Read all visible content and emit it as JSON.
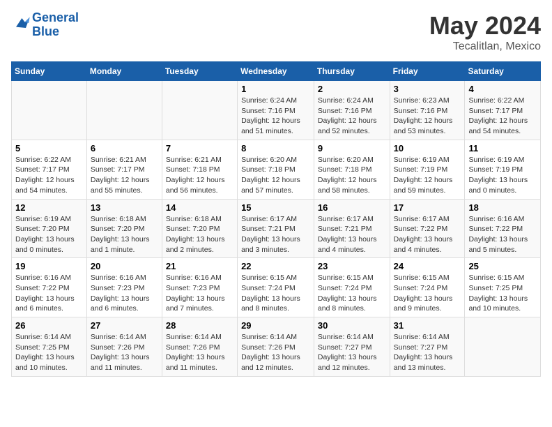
{
  "logo": {
    "line1": "General",
    "line2": "Blue"
  },
  "title": "May 2024",
  "location": "Tecalitlan, Mexico",
  "weekdays": [
    "Sunday",
    "Monday",
    "Tuesday",
    "Wednesday",
    "Thursday",
    "Friday",
    "Saturday"
  ],
  "weeks": [
    [
      {
        "day": "",
        "detail": ""
      },
      {
        "day": "",
        "detail": ""
      },
      {
        "day": "",
        "detail": ""
      },
      {
        "day": "1",
        "detail": "Sunrise: 6:24 AM\nSunset: 7:16 PM\nDaylight: 12 hours\nand 51 minutes."
      },
      {
        "day": "2",
        "detail": "Sunrise: 6:24 AM\nSunset: 7:16 PM\nDaylight: 12 hours\nand 52 minutes."
      },
      {
        "day": "3",
        "detail": "Sunrise: 6:23 AM\nSunset: 7:16 PM\nDaylight: 12 hours\nand 53 minutes."
      },
      {
        "day": "4",
        "detail": "Sunrise: 6:22 AM\nSunset: 7:17 PM\nDaylight: 12 hours\nand 54 minutes."
      }
    ],
    [
      {
        "day": "5",
        "detail": "Sunrise: 6:22 AM\nSunset: 7:17 PM\nDaylight: 12 hours\nand 54 minutes."
      },
      {
        "day": "6",
        "detail": "Sunrise: 6:21 AM\nSunset: 7:17 PM\nDaylight: 12 hours\nand 55 minutes."
      },
      {
        "day": "7",
        "detail": "Sunrise: 6:21 AM\nSunset: 7:18 PM\nDaylight: 12 hours\nand 56 minutes."
      },
      {
        "day": "8",
        "detail": "Sunrise: 6:20 AM\nSunset: 7:18 PM\nDaylight: 12 hours\nand 57 minutes."
      },
      {
        "day": "9",
        "detail": "Sunrise: 6:20 AM\nSunset: 7:18 PM\nDaylight: 12 hours\nand 58 minutes."
      },
      {
        "day": "10",
        "detail": "Sunrise: 6:19 AM\nSunset: 7:19 PM\nDaylight: 12 hours\nand 59 minutes."
      },
      {
        "day": "11",
        "detail": "Sunrise: 6:19 AM\nSunset: 7:19 PM\nDaylight: 13 hours\nand 0 minutes."
      }
    ],
    [
      {
        "day": "12",
        "detail": "Sunrise: 6:19 AM\nSunset: 7:20 PM\nDaylight: 13 hours\nand 0 minutes."
      },
      {
        "day": "13",
        "detail": "Sunrise: 6:18 AM\nSunset: 7:20 PM\nDaylight: 13 hours\nand 1 minute."
      },
      {
        "day": "14",
        "detail": "Sunrise: 6:18 AM\nSunset: 7:20 PM\nDaylight: 13 hours\nand 2 minutes."
      },
      {
        "day": "15",
        "detail": "Sunrise: 6:17 AM\nSunset: 7:21 PM\nDaylight: 13 hours\nand 3 minutes."
      },
      {
        "day": "16",
        "detail": "Sunrise: 6:17 AM\nSunset: 7:21 PM\nDaylight: 13 hours\nand 4 minutes."
      },
      {
        "day": "17",
        "detail": "Sunrise: 6:17 AM\nSunset: 7:22 PM\nDaylight: 13 hours\nand 4 minutes."
      },
      {
        "day": "18",
        "detail": "Sunrise: 6:16 AM\nSunset: 7:22 PM\nDaylight: 13 hours\nand 5 minutes."
      }
    ],
    [
      {
        "day": "19",
        "detail": "Sunrise: 6:16 AM\nSunset: 7:22 PM\nDaylight: 13 hours\nand 6 minutes."
      },
      {
        "day": "20",
        "detail": "Sunrise: 6:16 AM\nSunset: 7:23 PM\nDaylight: 13 hours\nand 6 minutes."
      },
      {
        "day": "21",
        "detail": "Sunrise: 6:16 AM\nSunset: 7:23 PM\nDaylight: 13 hours\nand 7 minutes."
      },
      {
        "day": "22",
        "detail": "Sunrise: 6:15 AM\nSunset: 7:24 PM\nDaylight: 13 hours\nand 8 minutes."
      },
      {
        "day": "23",
        "detail": "Sunrise: 6:15 AM\nSunset: 7:24 PM\nDaylight: 13 hours\nand 8 minutes."
      },
      {
        "day": "24",
        "detail": "Sunrise: 6:15 AM\nSunset: 7:24 PM\nDaylight: 13 hours\nand 9 minutes."
      },
      {
        "day": "25",
        "detail": "Sunrise: 6:15 AM\nSunset: 7:25 PM\nDaylight: 13 hours\nand 10 minutes."
      }
    ],
    [
      {
        "day": "26",
        "detail": "Sunrise: 6:14 AM\nSunset: 7:25 PM\nDaylight: 13 hours\nand 10 minutes."
      },
      {
        "day": "27",
        "detail": "Sunrise: 6:14 AM\nSunset: 7:26 PM\nDaylight: 13 hours\nand 11 minutes."
      },
      {
        "day": "28",
        "detail": "Sunrise: 6:14 AM\nSunset: 7:26 PM\nDaylight: 13 hours\nand 11 minutes."
      },
      {
        "day": "29",
        "detail": "Sunrise: 6:14 AM\nSunset: 7:26 PM\nDaylight: 13 hours\nand 12 minutes."
      },
      {
        "day": "30",
        "detail": "Sunrise: 6:14 AM\nSunset: 7:27 PM\nDaylight: 13 hours\nand 12 minutes."
      },
      {
        "day": "31",
        "detail": "Sunrise: 6:14 AM\nSunset: 7:27 PM\nDaylight: 13 hours\nand 13 minutes."
      },
      {
        "day": "",
        "detail": ""
      }
    ]
  ]
}
